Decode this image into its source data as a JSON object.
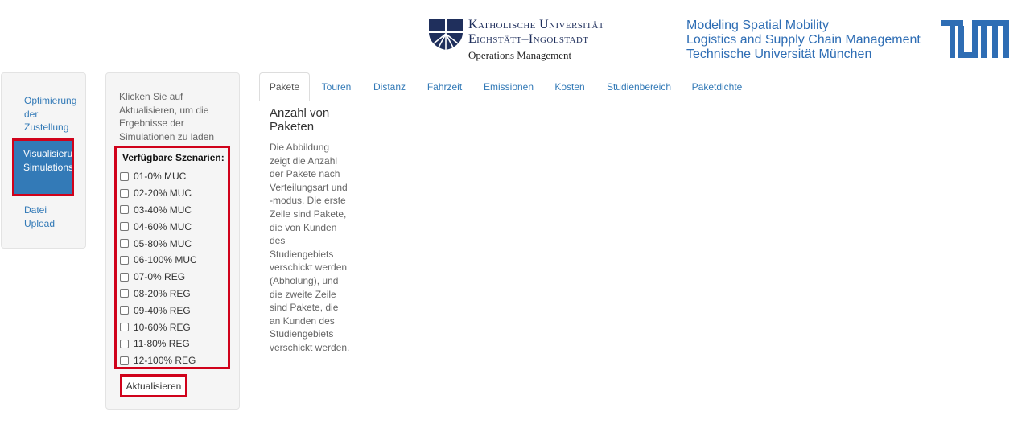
{
  "header": {
    "ku": {
      "line1": "Katholische Universität",
      "line2": "Eichstätt–Ingolstadt",
      "line3": "Operations Management"
    },
    "tum": {
      "line1": "Modeling Spatial Mobility",
      "line2": "Logistics and Supply Chain Management",
      "line3": "Technische Universität München"
    },
    "colors": {
      "ku_blue": "#1f2f5c",
      "tum_blue": "#2e6db4"
    }
  },
  "nav": {
    "items": [
      {
        "label": "Optimierung der Zustellung"
      },
      {
        "label": "Visualisierung des Simulationsergebnisse",
        "active": true
      },
      {
        "label": "Datei Upload"
      }
    ]
  },
  "sidebar": {
    "help_text": "Klicken Sie auf Aktualisieren, um die Ergebnisse der Simulationen zu laden",
    "scenarios_title": "Verfügbare Szenarien:",
    "scenarios": [
      "01-0% MUC",
      "02-20% MUC",
      "03-40% MUC",
      "04-60% MUC",
      "05-80% MUC",
      "06-100% MUC",
      "07-0% REG",
      "08-20% REG",
      "09-40% REG",
      "10-60% REG",
      "11-80% REG",
      "12-100% REG"
    ],
    "update_button": "Aktualisieren"
  },
  "tabs": [
    "Pakete",
    "Touren",
    "Distanz",
    "Fahrzeit",
    "Emissionen",
    "Kosten",
    "Studienbereich",
    "Paketdichte"
  ],
  "content": {
    "title": "Anzahl von Paketen",
    "text": "Die Abbildung zeigt die Anzahl der Pakete nach Verteilungsart und -modus. Die erste Zeile sind Pakete, die von Kunden des Studiengebiets verschickt werden (Abholung), und die zweite Zeile sind Pakete, die an Kunden des Studiengebiets verschickt werden."
  },
  "colors": {
    "highlight_red": "#d0021b",
    "link_blue": "#337ab7"
  }
}
